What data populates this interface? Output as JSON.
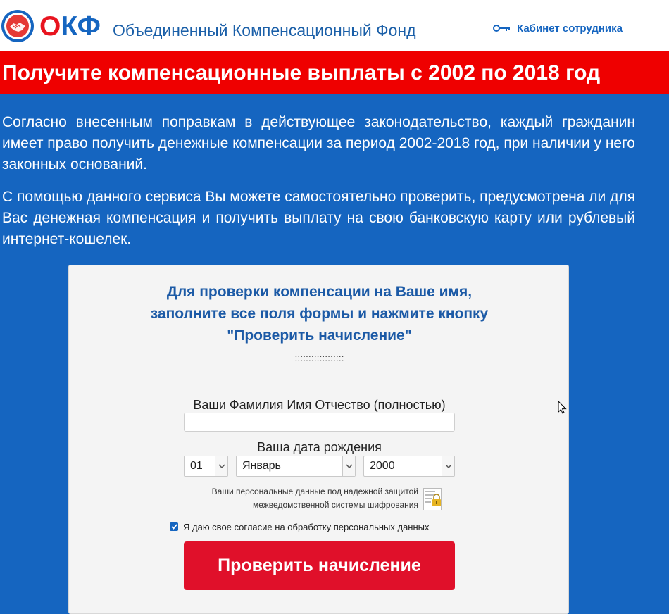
{
  "header": {
    "logo_letters": [
      "О",
      "КФ"
    ],
    "brand_name": "Объединенный Компенсационный Фонд",
    "cabinet_link": "Кабинет сотрудника"
  },
  "banner": {
    "title": "Получите компенсационные выплаты с 2002 по 2018 год"
  },
  "intro": {
    "paragraphs": [
      "Согласно внесенным поправкам в действующее законодательство, каждый гражданин имеет право получить денежные компенсации за период 2002-2018 год, при наличии у него законных оснований.",
      "С помощью данного сервиса Вы можете самостоятельно проверить, предусмотрена ли для Вас денежная компенсация и получить выплату на свою банковскую карту или рублевый интернет-кошелек."
    ]
  },
  "form": {
    "title_lines": [
      "Для проверки компенсации на Ваше имя,",
      "заполните все поля формы и нажмите кнопку",
      "\"Проверить начисление\""
    ],
    "separator": "::::::::::::::::::",
    "name_label": "Ваши Фамилия Имя Отчество (полностью)",
    "name_value": "",
    "dob_label": "Ваша дата рождения",
    "day": "01",
    "month": "Январь",
    "year": "2000",
    "security_lines": [
      "Ваши персональные данные под надежной защитой",
      "межведомственной системы шифрования"
    ],
    "consent_checked": true,
    "consent_label": "Я даю свое согласие на обработку персональных данных",
    "submit_label": "Проверить начисление"
  },
  "colors": {
    "background": "#1565c0",
    "banner": "#ef0000",
    "button": "#e0102a",
    "title_blue": "#1c5aa6"
  }
}
